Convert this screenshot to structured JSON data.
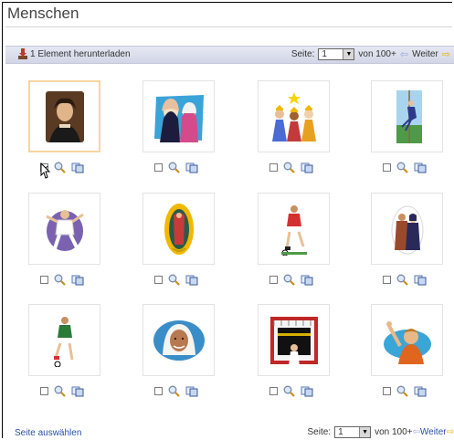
{
  "page": {
    "title": "Menschen"
  },
  "toolbar": {
    "download_label": "1 Element herunterladen",
    "pager": {
      "page_label": "Seite:",
      "page_value": "1",
      "of_label": "von 100+",
      "next_label": "Weiter"
    }
  },
  "images": [
    {
      "name": "portrait-painting",
      "selected": true
    },
    {
      "name": "two-women-headscarves",
      "selected": false
    },
    {
      "name": "three-kings",
      "selected": false
    },
    {
      "name": "rope-climber",
      "selected": false
    },
    {
      "name": "dancer",
      "selected": false
    },
    {
      "name": "virgin-of-guadalupe",
      "selected": false
    },
    {
      "name": "soccer-player-red",
      "selected": false
    },
    {
      "name": "women-in-hijab",
      "selected": false
    },
    {
      "name": "soccer-player-green",
      "selected": false
    },
    {
      "name": "woman-headscarf-portrait",
      "selected": false
    },
    {
      "name": "kaaba-pilgrim",
      "selected": false
    },
    {
      "name": "boy-waving",
      "selected": false
    }
  ],
  "footer": {
    "select_page_label": "Seite auswählen",
    "pager": {
      "page_label": "Seite:",
      "page_value": "1",
      "of_label": "von 100+",
      "next_label": "Weiter"
    }
  },
  "colors": {
    "accent_link": "#2a4fa8",
    "toolbar_bg": "#dcdfec",
    "selected_border": "#f5d5a0",
    "next_arrow": "#e8b400"
  }
}
